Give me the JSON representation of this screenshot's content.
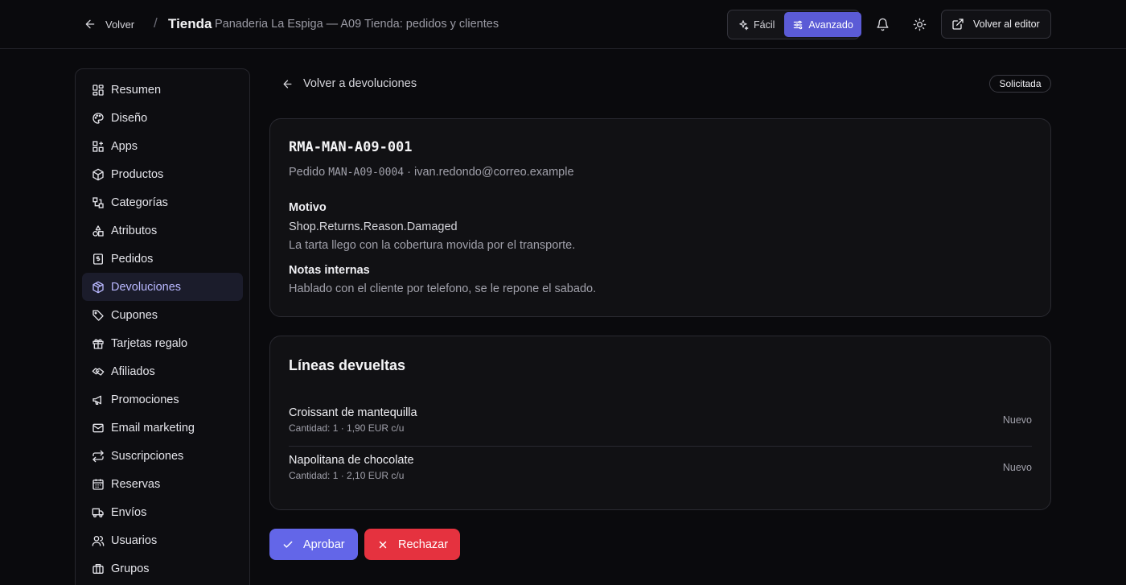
{
  "header": {
    "back_label": "Volver",
    "separator": "/",
    "title": "Tienda",
    "subtitle": "Panaderia La Espiga — A09 Tienda: pedidos y clientes",
    "mode_easy": "Fácil",
    "mode_advanced": "Avanzado",
    "editor_button": "Volver al editor"
  },
  "sidebar": {
    "items": [
      {
        "label": "Resumen",
        "icon": "dashboard-icon"
      },
      {
        "label": "Diseño",
        "icon": "palette-icon"
      },
      {
        "label": "Apps",
        "icon": "apps-icon"
      },
      {
        "label": "Productos",
        "icon": "package-icon"
      },
      {
        "label": "Categorías",
        "icon": "categories-icon"
      },
      {
        "label": "Atributos",
        "icon": "shapes-icon"
      },
      {
        "label": "Pedidos",
        "icon": "receipt-icon"
      },
      {
        "label": "Devoluciones",
        "icon": "return-package-icon"
      },
      {
        "label": "Cupones",
        "icon": "tag-icon"
      },
      {
        "label": "Tarjetas regalo",
        "icon": "gift-icon"
      },
      {
        "label": "Afiliados",
        "icon": "handshake-icon"
      },
      {
        "label": "Promociones",
        "icon": "megaphone-icon"
      },
      {
        "label": "Email marketing",
        "icon": "mail-icon"
      },
      {
        "label": "Suscripciones",
        "icon": "repeat-icon"
      },
      {
        "label": "Reservas",
        "icon": "calendar-icon"
      },
      {
        "label": "Envíos",
        "icon": "truck-icon"
      },
      {
        "label": "Usuarios",
        "icon": "users-icon"
      },
      {
        "label": "Grupos",
        "icon": "group-icon"
      }
    ],
    "active_index": 7
  },
  "main": {
    "back_label": "Volver a devoluciones",
    "status": "Solicitada",
    "rma": {
      "code": "RMA-MAN-A09-001",
      "order_prefix": "Pedido",
      "order_code": "MAN-A09-0004",
      "order_separator": "·",
      "customer_email": "ivan.redondo@correo.example",
      "reason_label": "Motivo",
      "reason_key": "Shop.Returns.Reason.Damaged",
      "reason_text": "La tarta llego con la cobertura movida por el transporte.",
      "notes_label": "Notas internas",
      "notes_text": "Hablado con el cliente por telefono, se le repone el sabado."
    },
    "lines": {
      "title": "Líneas devueltas",
      "items": [
        {
          "name": "Croissant de mantequilla",
          "qty": "Cantidad: 1 · 1,90 EUR c/u",
          "state": "Nuevo"
        },
        {
          "name": "Napolitana de chocolate",
          "qty": "Cantidad: 1 · 2,10 EUR c/u",
          "state": "Nuevo"
        }
      ]
    },
    "actions": {
      "approve": "Aprobar",
      "reject": "Rechazar"
    }
  },
  "colors": {
    "accent": "#6366e8",
    "danger": "#e5323f",
    "active_nav_bg": "#1b1c2b",
    "active_nav_text": "#b9b8ff"
  }
}
